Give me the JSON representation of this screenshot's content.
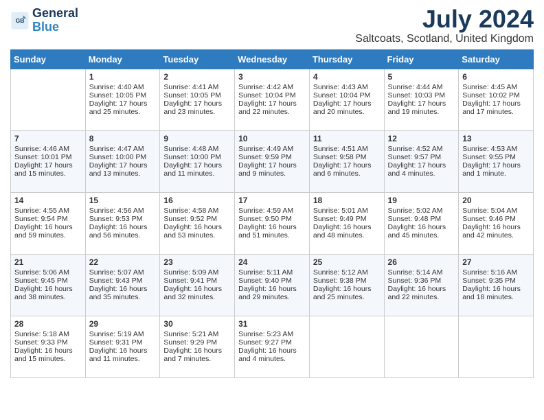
{
  "header": {
    "logo_line1": "General",
    "logo_line2": "Blue",
    "month_year": "July 2024",
    "location": "Saltcoats, Scotland, United Kingdom"
  },
  "days_of_week": [
    "Sunday",
    "Monday",
    "Tuesday",
    "Wednesday",
    "Thursday",
    "Friday",
    "Saturday"
  ],
  "weeks": [
    [
      {
        "day": "",
        "info": ""
      },
      {
        "day": "1",
        "info": "Sunrise: 4:40 AM\nSunset: 10:05 PM\nDaylight: 17 hours\nand 25 minutes."
      },
      {
        "day": "2",
        "info": "Sunrise: 4:41 AM\nSunset: 10:05 PM\nDaylight: 17 hours\nand 23 minutes."
      },
      {
        "day": "3",
        "info": "Sunrise: 4:42 AM\nSunset: 10:04 PM\nDaylight: 17 hours\nand 22 minutes."
      },
      {
        "day": "4",
        "info": "Sunrise: 4:43 AM\nSunset: 10:04 PM\nDaylight: 17 hours\nand 20 minutes."
      },
      {
        "day": "5",
        "info": "Sunrise: 4:44 AM\nSunset: 10:03 PM\nDaylight: 17 hours\nand 19 minutes."
      },
      {
        "day": "6",
        "info": "Sunrise: 4:45 AM\nSunset: 10:02 PM\nDaylight: 17 hours\nand 17 minutes."
      }
    ],
    [
      {
        "day": "7",
        "info": "Sunrise: 4:46 AM\nSunset: 10:01 PM\nDaylight: 17 hours\nand 15 minutes."
      },
      {
        "day": "8",
        "info": "Sunrise: 4:47 AM\nSunset: 10:00 PM\nDaylight: 17 hours\nand 13 minutes."
      },
      {
        "day": "9",
        "info": "Sunrise: 4:48 AM\nSunset: 10:00 PM\nDaylight: 17 hours\nand 11 minutes."
      },
      {
        "day": "10",
        "info": "Sunrise: 4:49 AM\nSunset: 9:59 PM\nDaylight: 17 hours\nand 9 minutes."
      },
      {
        "day": "11",
        "info": "Sunrise: 4:51 AM\nSunset: 9:58 PM\nDaylight: 17 hours\nand 6 minutes."
      },
      {
        "day": "12",
        "info": "Sunrise: 4:52 AM\nSunset: 9:57 PM\nDaylight: 17 hours\nand 4 minutes."
      },
      {
        "day": "13",
        "info": "Sunrise: 4:53 AM\nSunset: 9:55 PM\nDaylight: 17 hours\nand 1 minute."
      }
    ],
    [
      {
        "day": "14",
        "info": "Sunrise: 4:55 AM\nSunset: 9:54 PM\nDaylight: 16 hours\nand 59 minutes."
      },
      {
        "day": "15",
        "info": "Sunrise: 4:56 AM\nSunset: 9:53 PM\nDaylight: 16 hours\nand 56 minutes."
      },
      {
        "day": "16",
        "info": "Sunrise: 4:58 AM\nSunset: 9:52 PM\nDaylight: 16 hours\nand 53 minutes."
      },
      {
        "day": "17",
        "info": "Sunrise: 4:59 AM\nSunset: 9:50 PM\nDaylight: 16 hours\nand 51 minutes."
      },
      {
        "day": "18",
        "info": "Sunrise: 5:01 AM\nSunset: 9:49 PM\nDaylight: 16 hours\nand 48 minutes."
      },
      {
        "day": "19",
        "info": "Sunrise: 5:02 AM\nSunset: 9:48 PM\nDaylight: 16 hours\nand 45 minutes."
      },
      {
        "day": "20",
        "info": "Sunrise: 5:04 AM\nSunset: 9:46 PM\nDaylight: 16 hours\nand 42 minutes."
      }
    ],
    [
      {
        "day": "21",
        "info": "Sunrise: 5:06 AM\nSunset: 9:45 PM\nDaylight: 16 hours\nand 38 minutes."
      },
      {
        "day": "22",
        "info": "Sunrise: 5:07 AM\nSunset: 9:43 PM\nDaylight: 16 hours\nand 35 minutes."
      },
      {
        "day": "23",
        "info": "Sunrise: 5:09 AM\nSunset: 9:41 PM\nDaylight: 16 hours\nand 32 minutes."
      },
      {
        "day": "24",
        "info": "Sunrise: 5:11 AM\nSunset: 9:40 PM\nDaylight: 16 hours\nand 29 minutes."
      },
      {
        "day": "25",
        "info": "Sunrise: 5:12 AM\nSunset: 9:38 PM\nDaylight: 16 hours\nand 25 minutes."
      },
      {
        "day": "26",
        "info": "Sunrise: 5:14 AM\nSunset: 9:36 PM\nDaylight: 16 hours\nand 22 minutes."
      },
      {
        "day": "27",
        "info": "Sunrise: 5:16 AM\nSunset: 9:35 PM\nDaylight: 16 hours\nand 18 minutes."
      }
    ],
    [
      {
        "day": "28",
        "info": "Sunrise: 5:18 AM\nSunset: 9:33 PM\nDaylight: 16 hours\nand 15 minutes."
      },
      {
        "day": "29",
        "info": "Sunrise: 5:19 AM\nSunset: 9:31 PM\nDaylight: 16 hours\nand 11 minutes."
      },
      {
        "day": "30",
        "info": "Sunrise: 5:21 AM\nSunset: 9:29 PM\nDaylight: 16 hours\nand 7 minutes."
      },
      {
        "day": "31",
        "info": "Sunrise: 5:23 AM\nSunset: 9:27 PM\nDaylight: 16 hours\nand 4 minutes."
      },
      {
        "day": "",
        "info": ""
      },
      {
        "day": "",
        "info": ""
      },
      {
        "day": "",
        "info": ""
      }
    ]
  ]
}
